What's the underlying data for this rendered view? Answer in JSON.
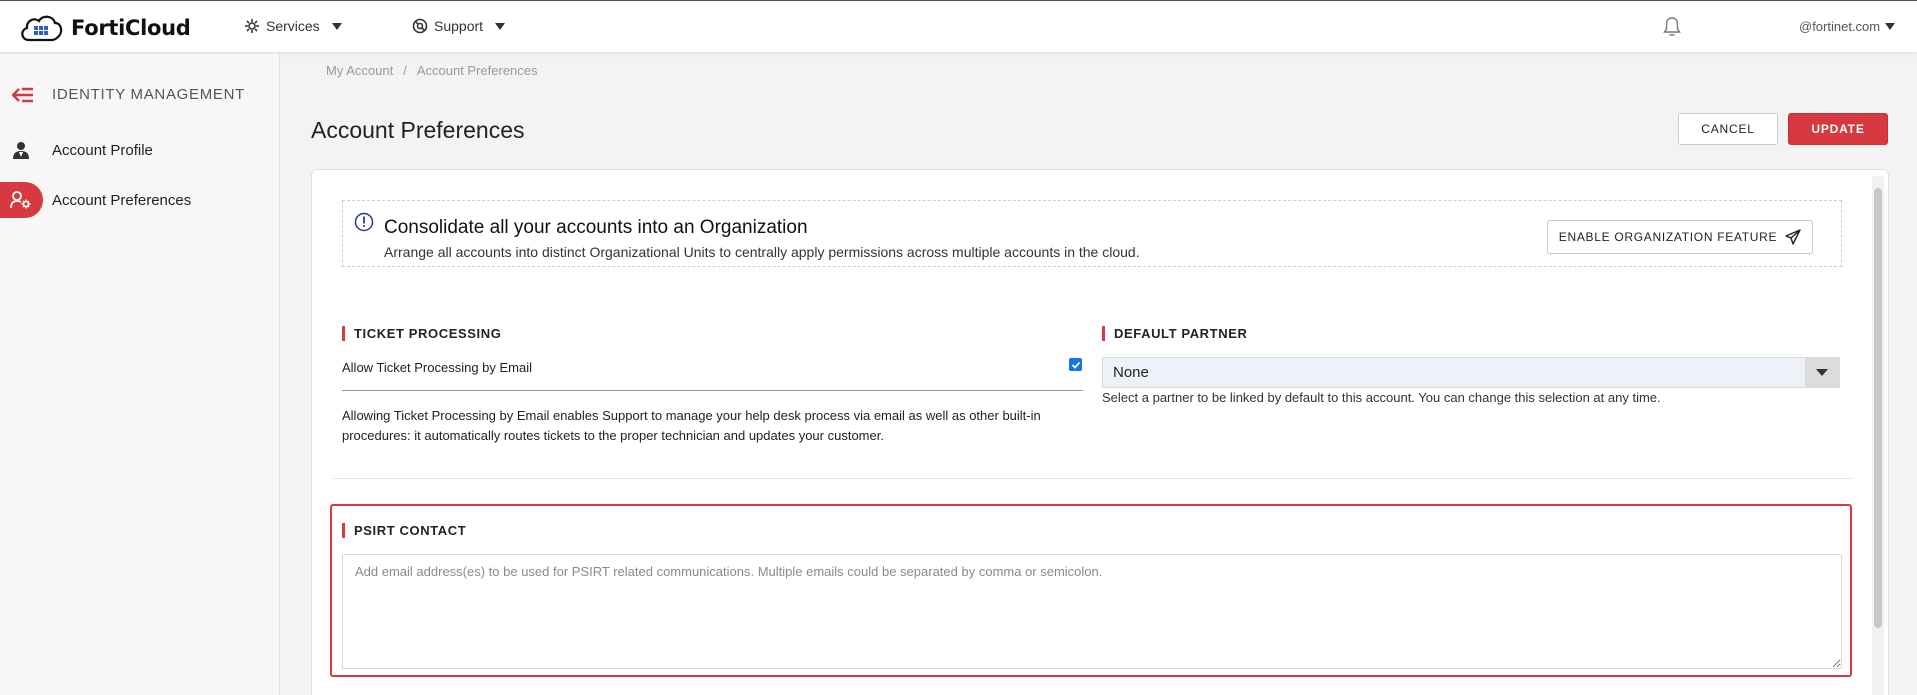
{
  "header": {
    "logo_text": "FortiCloud",
    "nav": {
      "services_label": "Services",
      "support_label": "Support"
    },
    "account_label": "@fortinet.com"
  },
  "sidebar": {
    "section_title": "IDENTITY MANAGEMENT",
    "items": [
      {
        "label": "Account Profile",
        "icon": "user-icon",
        "active": false
      },
      {
        "label": "Account Preferences",
        "icon": "user-settings-icon",
        "active": true
      }
    ]
  },
  "breadcrumb": {
    "items": [
      "My Account",
      "Account Preferences"
    ],
    "separator": "/"
  },
  "page": {
    "title": "Account Preferences",
    "cancel_label": "CANCEL",
    "update_label": "UPDATE"
  },
  "org_banner": {
    "title": "Consolidate all your accounts into an Organization",
    "description": "Arrange all accounts into distinct Organizational Units to centrally apply permissions across multiple accounts in the cloud.",
    "button_label": "ENABLE ORGANIZATION FEATURE"
  },
  "ticket_processing": {
    "heading": "TICKET PROCESSING",
    "checkbox_label": "Allow Ticket Processing by Email",
    "checked": true,
    "description": "Allowing Ticket Processing by Email enables Support to manage your help desk process via email as well as other built-in procedures: it automatically routes tickets to the proper technician and updates your customer."
  },
  "default_partner": {
    "heading": "DEFAULT PARTNER",
    "selected": "None",
    "hint": "Select a partner to be linked by default to this account. You can change this selection at any time."
  },
  "psirt": {
    "heading": "PSIRT CONTACT",
    "value": "",
    "placeholder": "Add email address(es) to be used for PSIRT related communications. Multiple emails could be separated by comma or semicolon."
  },
  "colors": {
    "accent": "#d6393f",
    "checkbox": "#1a73e8"
  }
}
